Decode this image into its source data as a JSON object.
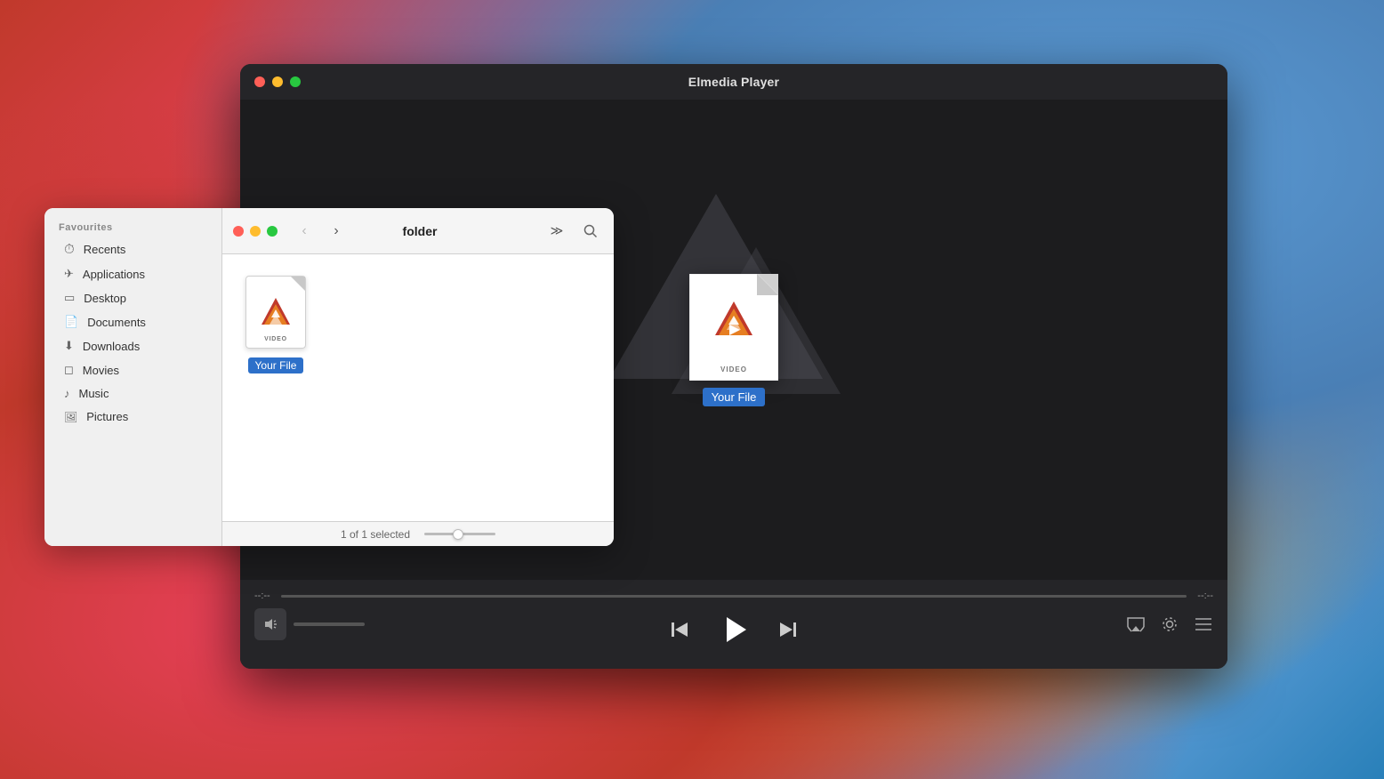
{
  "desktop": {
    "bg_color": "#c0392b"
  },
  "player": {
    "title": "Elmedia Player",
    "traffic_lights": {
      "close": "#ff5f57",
      "minimize": "#febc2e",
      "maximize": "#28c840"
    },
    "time_start": "--:--",
    "time_end": "--:--",
    "file_label": "VIDEO",
    "filename": "Your File",
    "controls": {
      "prev_label": "⏮",
      "play_label": "▶",
      "next_label": "⏭",
      "airplay_label": "airplay",
      "settings_label": "settings",
      "playlist_label": "playlist"
    }
  },
  "finder": {
    "title": "folder",
    "traffic_lights": {
      "close": "#ff5f57",
      "minimize": "#febc2e",
      "maximize": "#28c840"
    },
    "sidebar": {
      "section_label": "Favourites",
      "items": [
        {
          "id": "recents",
          "label": "Recents",
          "icon": "⏱"
        },
        {
          "id": "applications",
          "label": "Applications",
          "icon": "🚀"
        },
        {
          "id": "desktop",
          "label": "Desktop",
          "icon": "🖥"
        },
        {
          "id": "documents",
          "label": "Documents",
          "icon": "📄"
        },
        {
          "id": "downloads",
          "label": "Downloads",
          "icon": "⬇"
        },
        {
          "id": "movies",
          "label": "Movies",
          "icon": "🎬"
        },
        {
          "id": "music",
          "label": "Music",
          "icon": "🎵"
        },
        {
          "id": "pictures",
          "label": "Pictures",
          "icon": "🖼"
        }
      ]
    },
    "content": {
      "file": {
        "label": "VIDEO",
        "name": "Your File"
      }
    },
    "statusbar": {
      "text": "1 of 1 selected"
    }
  }
}
